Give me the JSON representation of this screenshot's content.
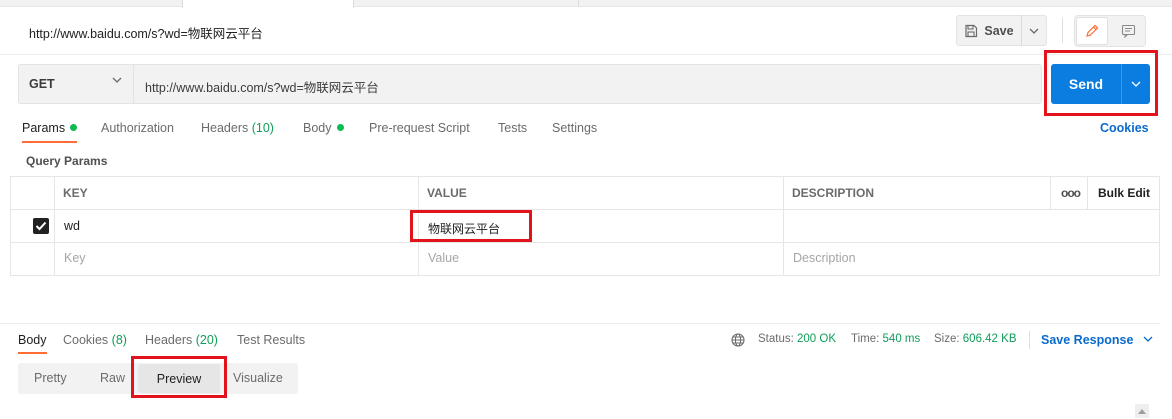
{
  "request": {
    "title": "http://www.baidu.com/s?wd=物联网云平台",
    "method": "GET",
    "url": "http://www.baidu.com/s?wd=物联网云平台"
  },
  "toolbar": {
    "save_label": "Save",
    "send_label": "Send"
  },
  "request_tabs": {
    "params": "Params",
    "authorization": "Authorization",
    "headers": "Headers",
    "headers_count": "(10)",
    "body": "Body",
    "prerequest": "Pre-request Script",
    "tests": "Tests",
    "settings": "Settings",
    "cookies": "Cookies"
  },
  "params": {
    "section_label": "Query Params",
    "columns": {
      "key": "KEY",
      "value": "VALUE",
      "description": "DESCRIPTION",
      "bulk_edit": "Bulk Edit",
      "more": "ooo"
    },
    "rows": [
      {
        "key": "wd",
        "value": "物联网云平台",
        "description": "",
        "checked": true
      }
    ],
    "placeholders": {
      "key": "Key",
      "value": "Value",
      "description": "Description"
    }
  },
  "response": {
    "tabs": {
      "body": "Body",
      "cookies": "Cookies",
      "cookies_count": "(8)",
      "headers": "Headers",
      "headers_count": "(20)",
      "test_results": "Test Results"
    },
    "status_label": "Status:",
    "status_value": "200 OK",
    "time_label": "Time:",
    "time_value": "540 ms",
    "size_label": "Size:",
    "size_value": "606.42 KB",
    "save_response": "Save Response",
    "views": {
      "pretty": "Pretty",
      "raw": "Raw",
      "preview": "Preview",
      "visualize": "Visualize"
    }
  },
  "colors": {
    "accent_orange": "#ff6c37",
    "send_blue": "#0b7de0",
    "link_blue": "#0b6bcb",
    "status_green": "#0f9d58",
    "highlight_red": "#e3131e"
  },
  "icons": {
    "save": "save-icon",
    "edit": "pencil-icon",
    "comment": "comment-icon",
    "globe": "globe-icon",
    "chevron": "chevron-down-icon",
    "checkbox": "checkbox-checked-icon"
  }
}
